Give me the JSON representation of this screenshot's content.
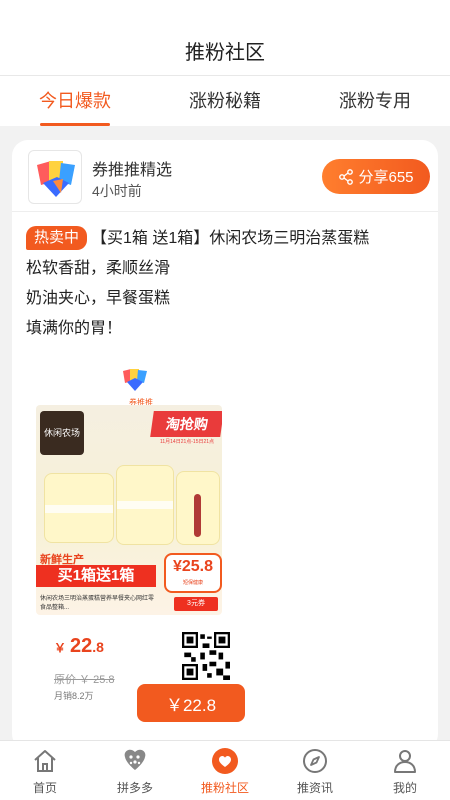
{
  "header": {
    "title": "推粉社区"
  },
  "tabs": [
    {
      "label": "今日爆款",
      "active": true
    },
    {
      "label": "涨粉秘籍",
      "active": false
    },
    {
      "label": "涨粉专用",
      "active": false
    }
  ],
  "post": {
    "author": "券推推精选",
    "time": "4小时前",
    "share_label": "分享655",
    "hot_badge": "热卖中",
    "text_lines": [
      "【买1箱 送1箱】休闲农场三明治蒸蛋糕",
      "松软香甜，柔顺丝滑",
      "奶油夹心，早餐蛋糕",
      "填满你的胃！"
    ]
  },
  "poster": {
    "logo_text": "券推推",
    "sponsor": "休闲农场",
    "tqg": "淘抢购",
    "tqg_sub": "11月14日21点-15日21点",
    "fresh": "新鲜生产",
    "promo": "买1箱送1箱",
    "product_desc": "休闲农场三明治蒸蛋糕营养早餐夹心网红零食品整箱...",
    "circle_price": "¥25.8",
    "circle_sub": "短保健康",
    "coupon": "3元券",
    "price_symbol": "￥",
    "price_int": "22",
    "price_dec": ".8",
    "original_price": "原价 ￥ 25.8",
    "sold": "月销8.2万",
    "buy_label": "￥22.8"
  },
  "nav": [
    {
      "label": "首页",
      "icon": "home-icon",
      "active": false
    },
    {
      "label": "拼多多",
      "icon": "pinduoduo-icon",
      "active": false
    },
    {
      "label": "推粉社区",
      "icon": "heart-icon",
      "active": true
    },
    {
      "label": "推资讯",
      "icon": "compass-icon",
      "active": false
    },
    {
      "label": "我的",
      "icon": "user-icon",
      "active": false
    }
  ],
  "colors": {
    "accent": "#f25a1f",
    "red": "#e93b3b"
  }
}
